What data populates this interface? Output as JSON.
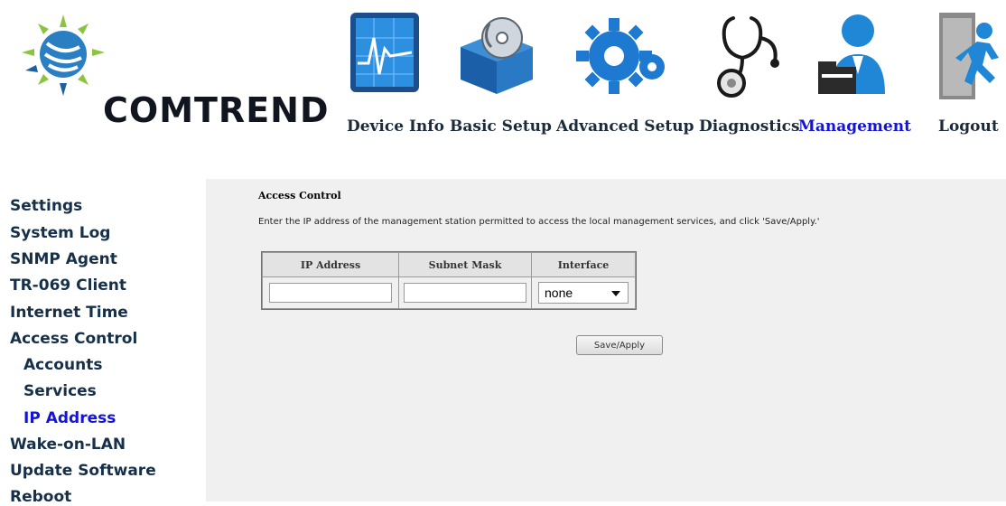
{
  "brand": {
    "name": "COMTREND"
  },
  "nav": [
    {
      "label": "Device Info",
      "icon": "device-info-chart-icon"
    },
    {
      "label": "Basic Setup",
      "icon": "box-cd-icon"
    },
    {
      "label": "Advanced Setup",
      "icon": "gears-icon"
    },
    {
      "label": "Diagnostics",
      "icon": "stethoscope-icon"
    },
    {
      "label": "Management",
      "icon": "manager-user-icon",
      "active": true
    },
    {
      "label": "Logout",
      "icon": "running-exit-icon"
    }
  ],
  "sidebar": {
    "items": [
      {
        "label": "Settings"
      },
      {
        "label": "System Log"
      },
      {
        "label": "SNMP Agent"
      },
      {
        "label": "TR-069 Client"
      },
      {
        "label": "Internet Time"
      },
      {
        "label": "Access Control"
      },
      {
        "label": "Accounts",
        "sub": true
      },
      {
        "label": "Services",
        "sub": true
      },
      {
        "label": "IP Address",
        "sub": true,
        "active": true
      },
      {
        "label": "Wake-on-LAN"
      },
      {
        "label": "Update Software"
      },
      {
        "label": "Reboot"
      }
    ]
  },
  "content": {
    "title": "Access Control",
    "instructions": "Enter the IP address of the management station permitted to access the local management services, and click 'Save/Apply.'",
    "table": {
      "headers": [
        "IP Address",
        "Subnet Mask",
        "Interface"
      ],
      "ip_value": "",
      "mask_value": "",
      "interface_selected": "none"
    },
    "save_label": "Save/Apply"
  },
  "colors": {
    "menu_text": "#17304a",
    "active_link": "#1414d6",
    "content_bg": "#f0f0f0"
  }
}
